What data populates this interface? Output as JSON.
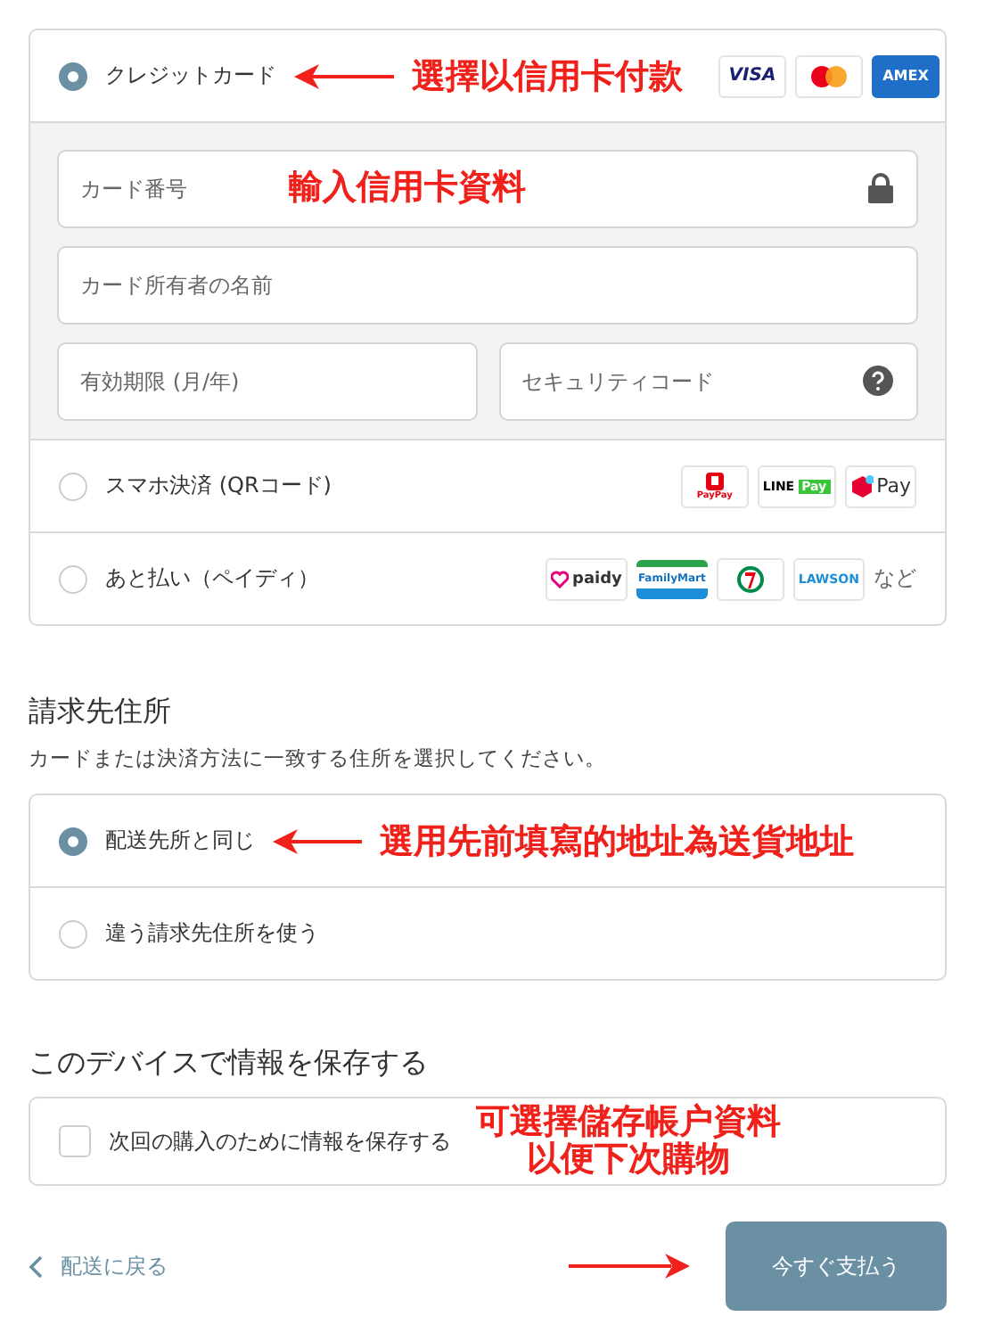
{
  "payment_methods": [
    {
      "label": "クレジットカード",
      "selected": true,
      "annotation": "選擇以信用卡付款",
      "logos": [
        {
          "kind": "visa",
          "text": "VISA"
        },
        {
          "kind": "master"
        },
        {
          "kind": "amex",
          "text": "AMEX"
        }
      ],
      "fields": [
        [
          {
            "placeholder": "カード番号",
            "kind": "secure",
            "annotation": "輸入信用卡資料"
          }
        ],
        [
          {
            "placeholder": "カード所有者の名前"
          }
        ],
        [
          {
            "placeholder": "有効期限 (月/年)"
          },
          {
            "placeholder": "セキュリティコード",
            "kind": "help"
          }
        ]
      ]
    },
    {
      "label": "スマホ決済 (QRコード)",
      "selected": false,
      "logos": [
        {
          "kind": "paypay",
          "text": "PayPay"
        },
        {
          "kind": "linepay",
          "text": "LINE",
          "text2": "Pay"
        },
        {
          "kind": "merpay",
          "text": "Pay"
        }
      ]
    },
    {
      "label": "あと払い（ペイディ）",
      "selected": false,
      "logos": [
        {
          "kind": "paidy",
          "text": "paidy"
        },
        {
          "kind": "family",
          "text": "FamilyMart"
        },
        {
          "kind": "seven"
        },
        {
          "kind": "lawson",
          "text": "LAWSON"
        }
      ],
      "suffix": "など"
    }
  ],
  "billing": {
    "title": "請求先住所",
    "subtitle": "カードまたは決済方法に一致する住所を選択してください。",
    "options": [
      {
        "label": "配送先所と同じ",
        "selected": true,
        "annotation": "選用先前填寫的地址為送貨地址"
      },
      {
        "label": "違う請求先住所を使う",
        "selected": false
      }
    ]
  },
  "save": {
    "title": "このデバイスで情報を保存する",
    "checkbox": {
      "label": "次回の購入のために情報を保存する",
      "checked": false
    },
    "annotation": [
      "可選擇儲存帳户資料",
      "以便下次購物"
    ]
  },
  "footer": {
    "back": "配送に戻る",
    "pay": "今すぐ支払う"
  }
}
